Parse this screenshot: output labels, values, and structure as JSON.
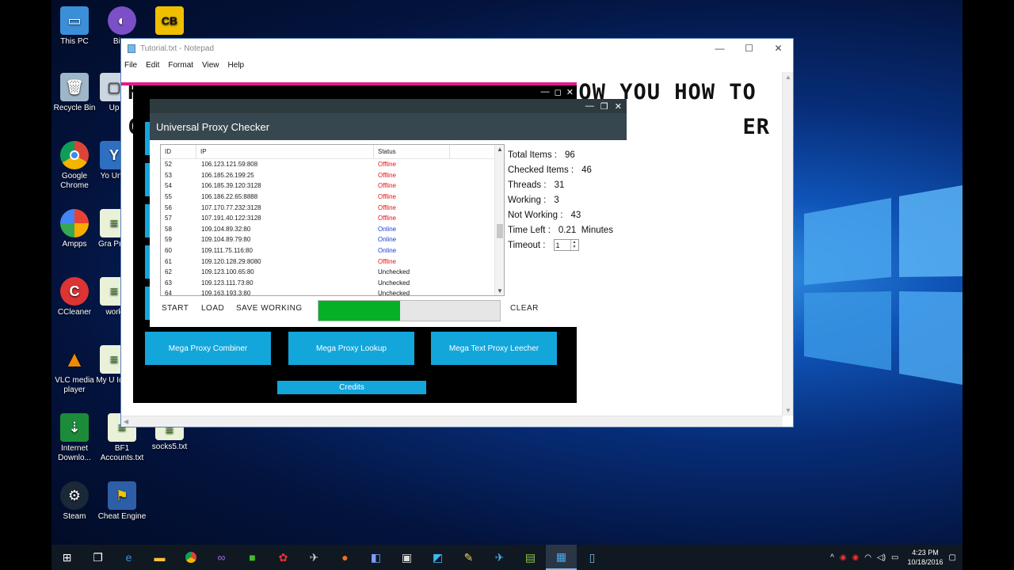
{
  "desktop": {
    "icons": [
      {
        "label": "This PC",
        "icon": "this-pc-icon"
      },
      {
        "label": "BitTo",
        "icon": "bittorrent-icon"
      },
      {
        "label": "",
        "icon": "cb-icon"
      },
      {
        "label": "Recycle Bin",
        "icon": "recycle-bin-icon"
      },
      {
        "label": "Up",
        "icon": "app-icon"
      },
      {
        "label": "Google Chrome",
        "icon": "chrome-icon"
      },
      {
        "label": "Yo Unin",
        "icon": "uninstaller-icon"
      },
      {
        "label": "Ampps",
        "icon": "ampps-icon"
      },
      {
        "label": "Gra Prox",
        "icon": "file-icon"
      },
      {
        "label": "CCleaner",
        "icon": "ccleaner-icon"
      },
      {
        "label": "work",
        "icon": "file-icon"
      },
      {
        "label": "VLC media player",
        "icon": "vlc-icon"
      },
      {
        "label": "My U Idea",
        "icon": "file-icon"
      },
      {
        "label": "Internet Downlo...",
        "icon": "idm-icon"
      },
      {
        "label": "BF1 Accounts.txt",
        "icon": "file-icon"
      },
      {
        "label": "socks5.txt",
        "icon": "file-icon"
      },
      {
        "label": "Steam",
        "icon": "steam-icon"
      },
      {
        "label": "Cheat Engine",
        "icon": "cheat-engine-icon"
      }
    ]
  },
  "notepad": {
    "title": "Tutorial.txt - Notepad",
    "menu": [
      "File",
      "Edit",
      "Format",
      "View",
      "Help"
    ],
    "line1": "HELLO GUYS TODAY I AM GOING TO SHOW YOU HOW TO",
    "line2": "C                                            ER"
  },
  "checker": {
    "title": "Universal Proxy Checker",
    "columns": [
      "ID",
      "IP",
      "Status"
    ],
    "rows": [
      {
        "id": "52",
        "ip": "106.123.121.59:808",
        "status": "Offline"
      },
      {
        "id": "53",
        "ip": "106.185.26.199:25",
        "status": "Offline"
      },
      {
        "id": "54",
        "ip": "106.185.39.120:3128",
        "status": "Offline"
      },
      {
        "id": "55",
        "ip": "106.186.22.65:8888",
        "status": "Offline"
      },
      {
        "id": "56",
        "ip": "107.170.77.232:3128",
        "status": "Offline"
      },
      {
        "id": "57",
        "ip": "107.191.40.122:3128",
        "status": "Offline"
      },
      {
        "id": "58",
        "ip": "109.104.89.32:80",
        "status": "Online"
      },
      {
        "id": "59",
        "ip": "109.104.89.79:80",
        "status": "Online"
      },
      {
        "id": "60",
        "ip": "109.111.75.116:80",
        "status": "Online"
      },
      {
        "id": "61",
        "ip": "109.120.128.29:8080",
        "status": "Offline"
      },
      {
        "id": "62",
        "ip": "109.123.100.65:80",
        "status": "Unchecked"
      },
      {
        "id": "63",
        "ip": "109.123.111.73:80",
        "status": "Unchecked"
      },
      {
        "id": "64",
        "ip": "109.163.193.3:80",
        "status": "Unchecked"
      }
    ],
    "buttons": {
      "start": "START",
      "load": "LOAD",
      "save_working": "SAVE WORKING",
      "clear": "CLEAR"
    },
    "progress": 0.45,
    "stats": {
      "total_label": "Total Items :",
      "total": "96",
      "checked_label": "Checked Items :",
      "checked": "46",
      "threads_label": "Threads :",
      "threads": "31",
      "working_label": "Working :",
      "working": "3",
      "not_working_label": "Not Working :",
      "not_working": "43",
      "time_left_label": "Time Left :",
      "time_left": "0.21",
      "time_unit": "Minutes",
      "timeout_label": "Timeout :",
      "timeout": "1"
    }
  },
  "tools": {
    "combiner": "Mega Proxy Combiner",
    "lookup": "Mega Proxy Lookup",
    "leecher": "Mega Text Proxy Leecher",
    "credits": "Credits"
  },
  "taskbar": {
    "apps": [
      "start-icon",
      "task-view-icon",
      "edge-icon",
      "file-explorer-icon",
      "chrome-icon",
      "visual-studio-icon",
      "jd-icon",
      "app-icon",
      "app-icon",
      "app-icon",
      "app-icon",
      "app-icon",
      "app-icon",
      "app-icon",
      "app-icon",
      "app-icon",
      "app-icon",
      "app-icon"
    ],
    "time": "4:23 PM",
    "date": "10/18/2016"
  },
  "colors": {
    "accent": "#12a6db",
    "header": "#37474f",
    "progress": "#06b025",
    "offline": "#e11111",
    "online": "#1a3fd1"
  }
}
